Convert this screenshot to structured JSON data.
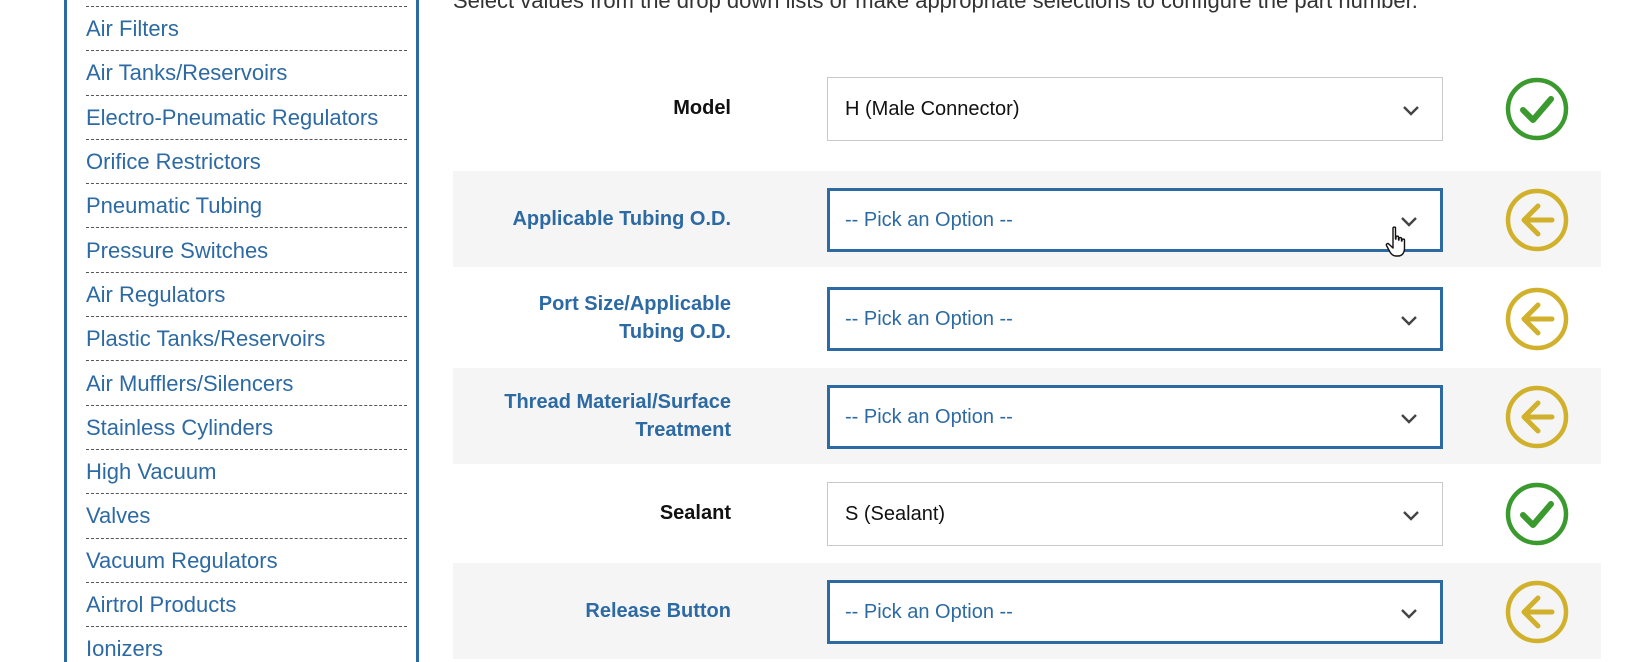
{
  "intro_text": "Select values from the drop down lists or make appropriate selections to configure the part number.",
  "sidebar": {
    "items": [
      {
        "label": "Air Filters"
      },
      {
        "label": "Air Tanks/Reservoirs"
      },
      {
        "label": "Electro-Pneumatic Regulators"
      },
      {
        "label": "Orifice Restrictors"
      },
      {
        "label": "Pneumatic Tubing"
      },
      {
        "label": "Pressure Switches"
      },
      {
        "label": "Air Regulators"
      },
      {
        "label": "Plastic Tanks/Reservoirs"
      },
      {
        "label": "Air Mufflers/Silencers"
      },
      {
        "label": "Stainless Cylinders"
      },
      {
        "label": "High Vacuum"
      },
      {
        "label": "Valves"
      },
      {
        "label": "Vacuum Regulators"
      },
      {
        "label": "Airtrol Products"
      },
      {
        "label": "Ionizers"
      }
    ]
  },
  "config": {
    "rows": [
      {
        "label": "Model",
        "value": "H (Male Connector)",
        "status": "complete",
        "status_icon": "green-check-circle-icon"
      },
      {
        "label": "Applicable Tubing O.D.",
        "value": "-- Pick an Option --",
        "status": "pending",
        "status_icon": "yellow-arrow-left-circle-icon"
      },
      {
        "label_line1": "Port Size/Applicable",
        "label_line2": "Tubing O.D.",
        "value": "-- Pick an Option --",
        "status": "pending",
        "status_icon": "yellow-arrow-left-circle-icon"
      },
      {
        "label_line1": "Thread Material/Surface",
        "label_line2": "Treatment",
        "value": "-- Pick an Option --",
        "status": "pending",
        "status_icon": "yellow-arrow-left-circle-icon"
      },
      {
        "label": "Sealant",
        "value": "S (Sealant)",
        "status": "complete",
        "status_icon": "green-check-circle-icon"
      },
      {
        "label": "Release Button",
        "value": "-- Pick an Option --",
        "status": "pending",
        "status_icon": "yellow-arrow-left-circle-icon"
      }
    ]
  },
  "colors": {
    "link_blue": "#2d6aa3",
    "check_green": "#3a9a2e",
    "arrow_yellow": "#d1b12c",
    "row_shade": "#f5f5f5"
  }
}
